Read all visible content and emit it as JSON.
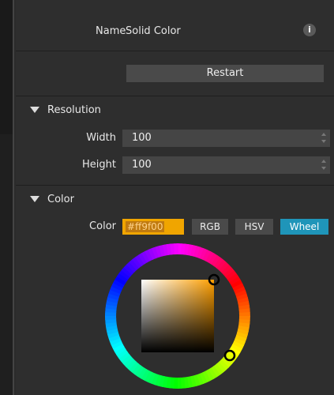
{
  "name_row": {
    "label": "Name",
    "value": "Solid Color",
    "info_glyph": "i"
  },
  "restart_label": "Restart",
  "resolution": {
    "title": "Resolution",
    "width_label": "Width",
    "width_value": "100",
    "height_label": "Height",
    "height_value": "100"
  },
  "color": {
    "title": "Color",
    "field_label": "Color",
    "hex_value": "#ff9f00",
    "modes": [
      "RGB",
      "HSV",
      "Wheel"
    ],
    "active_mode": "Wheel",
    "accent": "#1f95b9",
    "selected_color": "#ff9f00"
  }
}
